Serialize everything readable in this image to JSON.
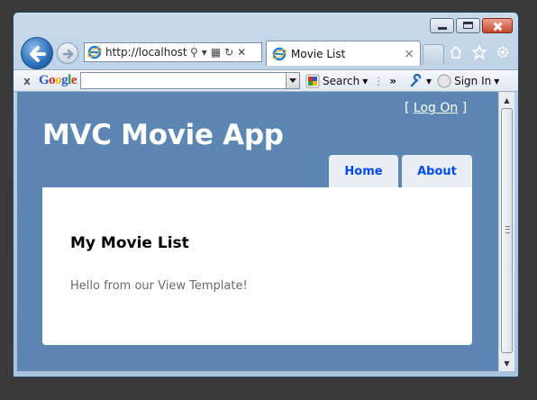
{
  "browser": {
    "address_url": "http://localhost:",
    "tab_title": "Movie List",
    "tab_close": "×",
    "icons": [
      "back-icon",
      "forward-icon",
      "ie-page-icon",
      "search-icon",
      "dropdown-icon",
      "compat-view-icon",
      "refresh-icon",
      "stop-icon",
      "home-icon",
      "favorites-star-icon",
      "tools-gear-icon"
    ]
  },
  "google_toolbar": {
    "close": "x",
    "logo_letters": [
      "G",
      "o",
      "o",
      "g",
      "l",
      "e"
    ],
    "logo_colors": [
      "#2a5bd7",
      "#d62d20",
      "#f4b400",
      "#2a5bd7",
      "#2a9d3c",
      "#d62d20"
    ],
    "search_label": "Search",
    "more": "»",
    "sign_in": "Sign In"
  },
  "page": {
    "login_open": "[ ",
    "login_link": "Log On",
    "login_close": " ]",
    "site_title": "MVC Movie App",
    "menu": [
      {
        "label": "Home"
      },
      {
        "label": "About"
      }
    ],
    "heading": "My Movie List",
    "body_text": "Hello from our View Template!"
  },
  "colors": {
    "page_bg": "#5c87b2",
    "menu_text": "#034af3",
    "body_text": "#696969"
  }
}
